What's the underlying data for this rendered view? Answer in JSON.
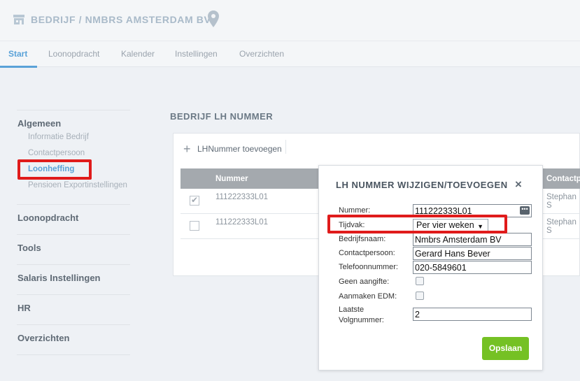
{
  "header": {
    "title": "BEDRIJF / NMBRS AMSTERDAM BV",
    "building_icon": "building-icon",
    "location_icon": "map-pin-icon"
  },
  "tabs": [
    {
      "label": "Start"
    },
    {
      "label": "Loonopdracht"
    },
    {
      "label": "Kalender"
    },
    {
      "label": "Instellingen"
    },
    {
      "label": "Overzichten"
    }
  ],
  "sidebar": {
    "sections": [
      {
        "label": "Algemeen"
      },
      {
        "label": "Loonopdracht"
      },
      {
        "label": "Tools"
      },
      {
        "label": "Salaris Instellingen"
      },
      {
        "label": "HR"
      },
      {
        "label": "Overzichten"
      }
    ],
    "items": [
      {
        "label": "Informatie Bedrijf"
      },
      {
        "label": "Contactpersoon"
      },
      {
        "label": "Loonheffing"
      },
      {
        "label": "Pensioen Exportinstellingen"
      }
    ]
  },
  "main": {
    "title": "BEDRIJF LH NUMMER",
    "add_label": "LHNummer toevoegen",
    "columns": [
      "Nummer",
      "Contactp"
    ],
    "rows": [
      {
        "nummer": "111222333L01",
        "contact": "Stephan S",
        "checked": true
      },
      {
        "nummer": "111222333L01",
        "contact": "Stephan S",
        "checked": false
      }
    ]
  },
  "modal": {
    "title": "LH NUMMER WIJZIGEN/TOEVOEGEN",
    "close": "×",
    "labels": {
      "nummer": "Nummer:",
      "tijdvak": "Tijdvak:",
      "bedrijfsnaam": "Bedrijfsnaam:",
      "contactpersoon": "Contactpersoon:",
      "telefoon": "Telefoonnummer:",
      "geen_aangifte": "Geen aangifte:",
      "aanmaken_edm": "Aanmaken EDM:",
      "laatste1": "Laatste",
      "laatste2": "Volgnummer:"
    },
    "values": {
      "nummer": "111222333L01",
      "tijdvak": "Per vier weken",
      "bedrijfsnaam": "Nmbrs Amsterdam BV",
      "contactpersoon": "Gerard Hans Bever",
      "telefoon": "020-5849601",
      "volgnummer": "2"
    },
    "dots": "•••",
    "select_arrow": "▼",
    "save": "Opslaan"
  },
  "colors": {
    "accent": "#5aa2d8",
    "highlight": "#e01b1b",
    "save": "#75c124"
  }
}
